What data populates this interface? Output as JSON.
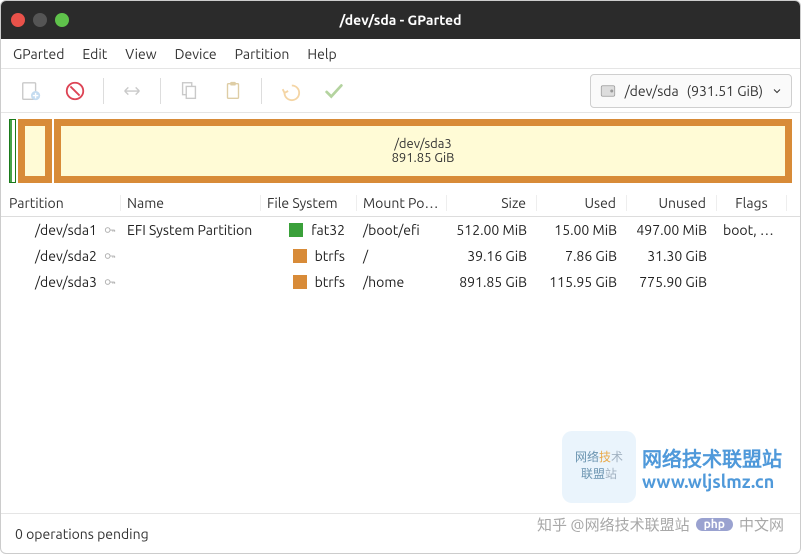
{
  "window": {
    "title": "/dev/sda - GParted"
  },
  "menu": {
    "gparted": "GParted",
    "edit": "Edit",
    "view": "View",
    "device": "Device",
    "partition": "Partition",
    "help": "Help"
  },
  "toolbar": {
    "device_label": "/dev/sda",
    "device_size": "(931.51 GiB)"
  },
  "diskbar": {
    "big_label": "/dev/sda3",
    "big_size": "891.85 GiB"
  },
  "headers": {
    "partition": "Partition",
    "name": "Name",
    "filesystem": "File System",
    "mountpoint": "Mount Point",
    "size": "Size",
    "used": "Used",
    "unused": "Unused",
    "flags": "Flags"
  },
  "rows": [
    {
      "partition": "/dev/sda1",
      "name": "EFI System Partition",
      "fs": "fat32",
      "fscolor": "green",
      "mount": "/boot/efi",
      "size": "512.00 MiB",
      "used": "15.00 MiB",
      "unused": "497.00 MiB",
      "flags": "boot, esp"
    },
    {
      "partition": "/dev/sda2",
      "name": "",
      "fs": "btrfs",
      "fscolor": "orange",
      "mount": "/",
      "size": "39.16 GiB",
      "used": "7.86 GiB",
      "unused": "31.30 GiB",
      "flags": ""
    },
    {
      "partition": "/dev/sda3",
      "name": "",
      "fs": "btrfs",
      "fscolor": "orange",
      "mount": "/home",
      "size": "891.85 GiB",
      "used": "115.95 GiB",
      "unused": "775.90 GiB",
      "flags": ""
    }
  ],
  "status": {
    "pending": "0 operations pending"
  },
  "watermark": {
    "box_line1a": "网络",
    "box_line1b": "技",
    "box_line1c": "术",
    "box_line2a": "联盟",
    "box_line2b": "站",
    "title": "网络技术联盟站",
    "url": "www.wljslmz.cn",
    "zhihu": "知乎 @网络技术联盟站",
    "php_badge": "php",
    "php_tail": "中文网"
  }
}
